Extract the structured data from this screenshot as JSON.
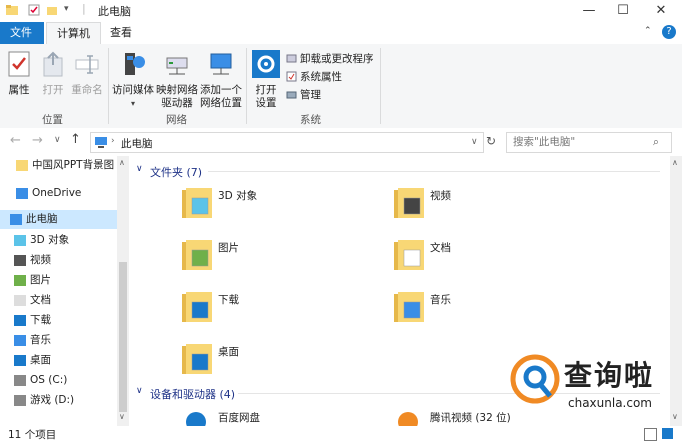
{
  "window": {
    "title": "此电脑",
    "controls": {
      "minimize": "—",
      "maximize": "☐",
      "close": "✕"
    }
  },
  "ribbon_tabs": [
    "文件",
    "计算机",
    "查看"
  ],
  "ribbon": {
    "location_group": {
      "label": "位置",
      "buttons": [
        "属性",
        "打开",
        "重命名"
      ]
    },
    "network_group": {
      "label": "网络",
      "buttons": [
        {
          "line1": "访问媒体",
          "line2": ""
        },
        {
          "line1": "映射网络",
          "line2": "驱动器"
        },
        {
          "line1": "添加一个",
          "line2": "网络位置"
        }
      ]
    },
    "system_group": {
      "label": "系统",
      "big_button": {
        "line1": "打开",
        "line2": "设置"
      },
      "small_buttons": [
        "卸载或更改程序",
        "系统属性",
        "管理"
      ]
    }
  },
  "address": {
    "path": "此电脑",
    "search_placeholder": "搜索\"此电脑\""
  },
  "nav": {
    "items": [
      {
        "label": "中国风PPT背景图",
        "icon": "folder-icon"
      },
      {
        "label": "OneDrive",
        "icon": "cloud-icon"
      },
      {
        "label": "此电脑",
        "icon": "computer-icon"
      },
      {
        "label": "3D 对象",
        "icon": "3d-objects-icon"
      },
      {
        "label": "视频",
        "icon": "video-icon"
      },
      {
        "label": "图片",
        "icon": "pictures-icon"
      },
      {
        "label": "文档",
        "icon": "documents-icon"
      },
      {
        "label": "下载",
        "icon": "download-icon"
      },
      {
        "label": "音乐",
        "icon": "music-icon"
      },
      {
        "label": "桌面",
        "icon": "desktop-icon"
      },
      {
        "label": "OS (C:)",
        "icon": "drive-icon"
      },
      {
        "label": "游戏 (D:)",
        "icon": "drive-icon"
      }
    ]
  },
  "content": {
    "folders_header": "文件夹 (7)",
    "folders": [
      {
        "name": "3D 对象",
        "icon": "3d-objects-folder-icon"
      },
      {
        "name": "视频",
        "icon": "video-folder-icon"
      },
      {
        "name": "图片",
        "icon": "pictures-folder-icon"
      },
      {
        "name": "文档",
        "icon": "documents-folder-icon"
      },
      {
        "name": "下载",
        "icon": "download-folder-icon"
      },
      {
        "name": "音乐",
        "icon": "music-folder-icon"
      },
      {
        "name": "桌面",
        "icon": "desktop-folder-icon"
      }
    ],
    "devices_header": "设备和驱动器 (4)",
    "devices": [
      {
        "name": "百度网盘",
        "icon": "baidu-netdisk-icon"
      },
      {
        "name": "腾讯视频 (32 位)",
        "icon": "tencent-video-icon"
      }
    ]
  },
  "status": {
    "count": "11 个项目"
  },
  "watermark": {
    "brand": "查询啦",
    "url": "chaxunla.com"
  },
  "colors": {
    "accent": "#1979ca",
    "selection": "#cce8ff",
    "folder": "#f8d775",
    "header_blue": "#1e3287"
  }
}
